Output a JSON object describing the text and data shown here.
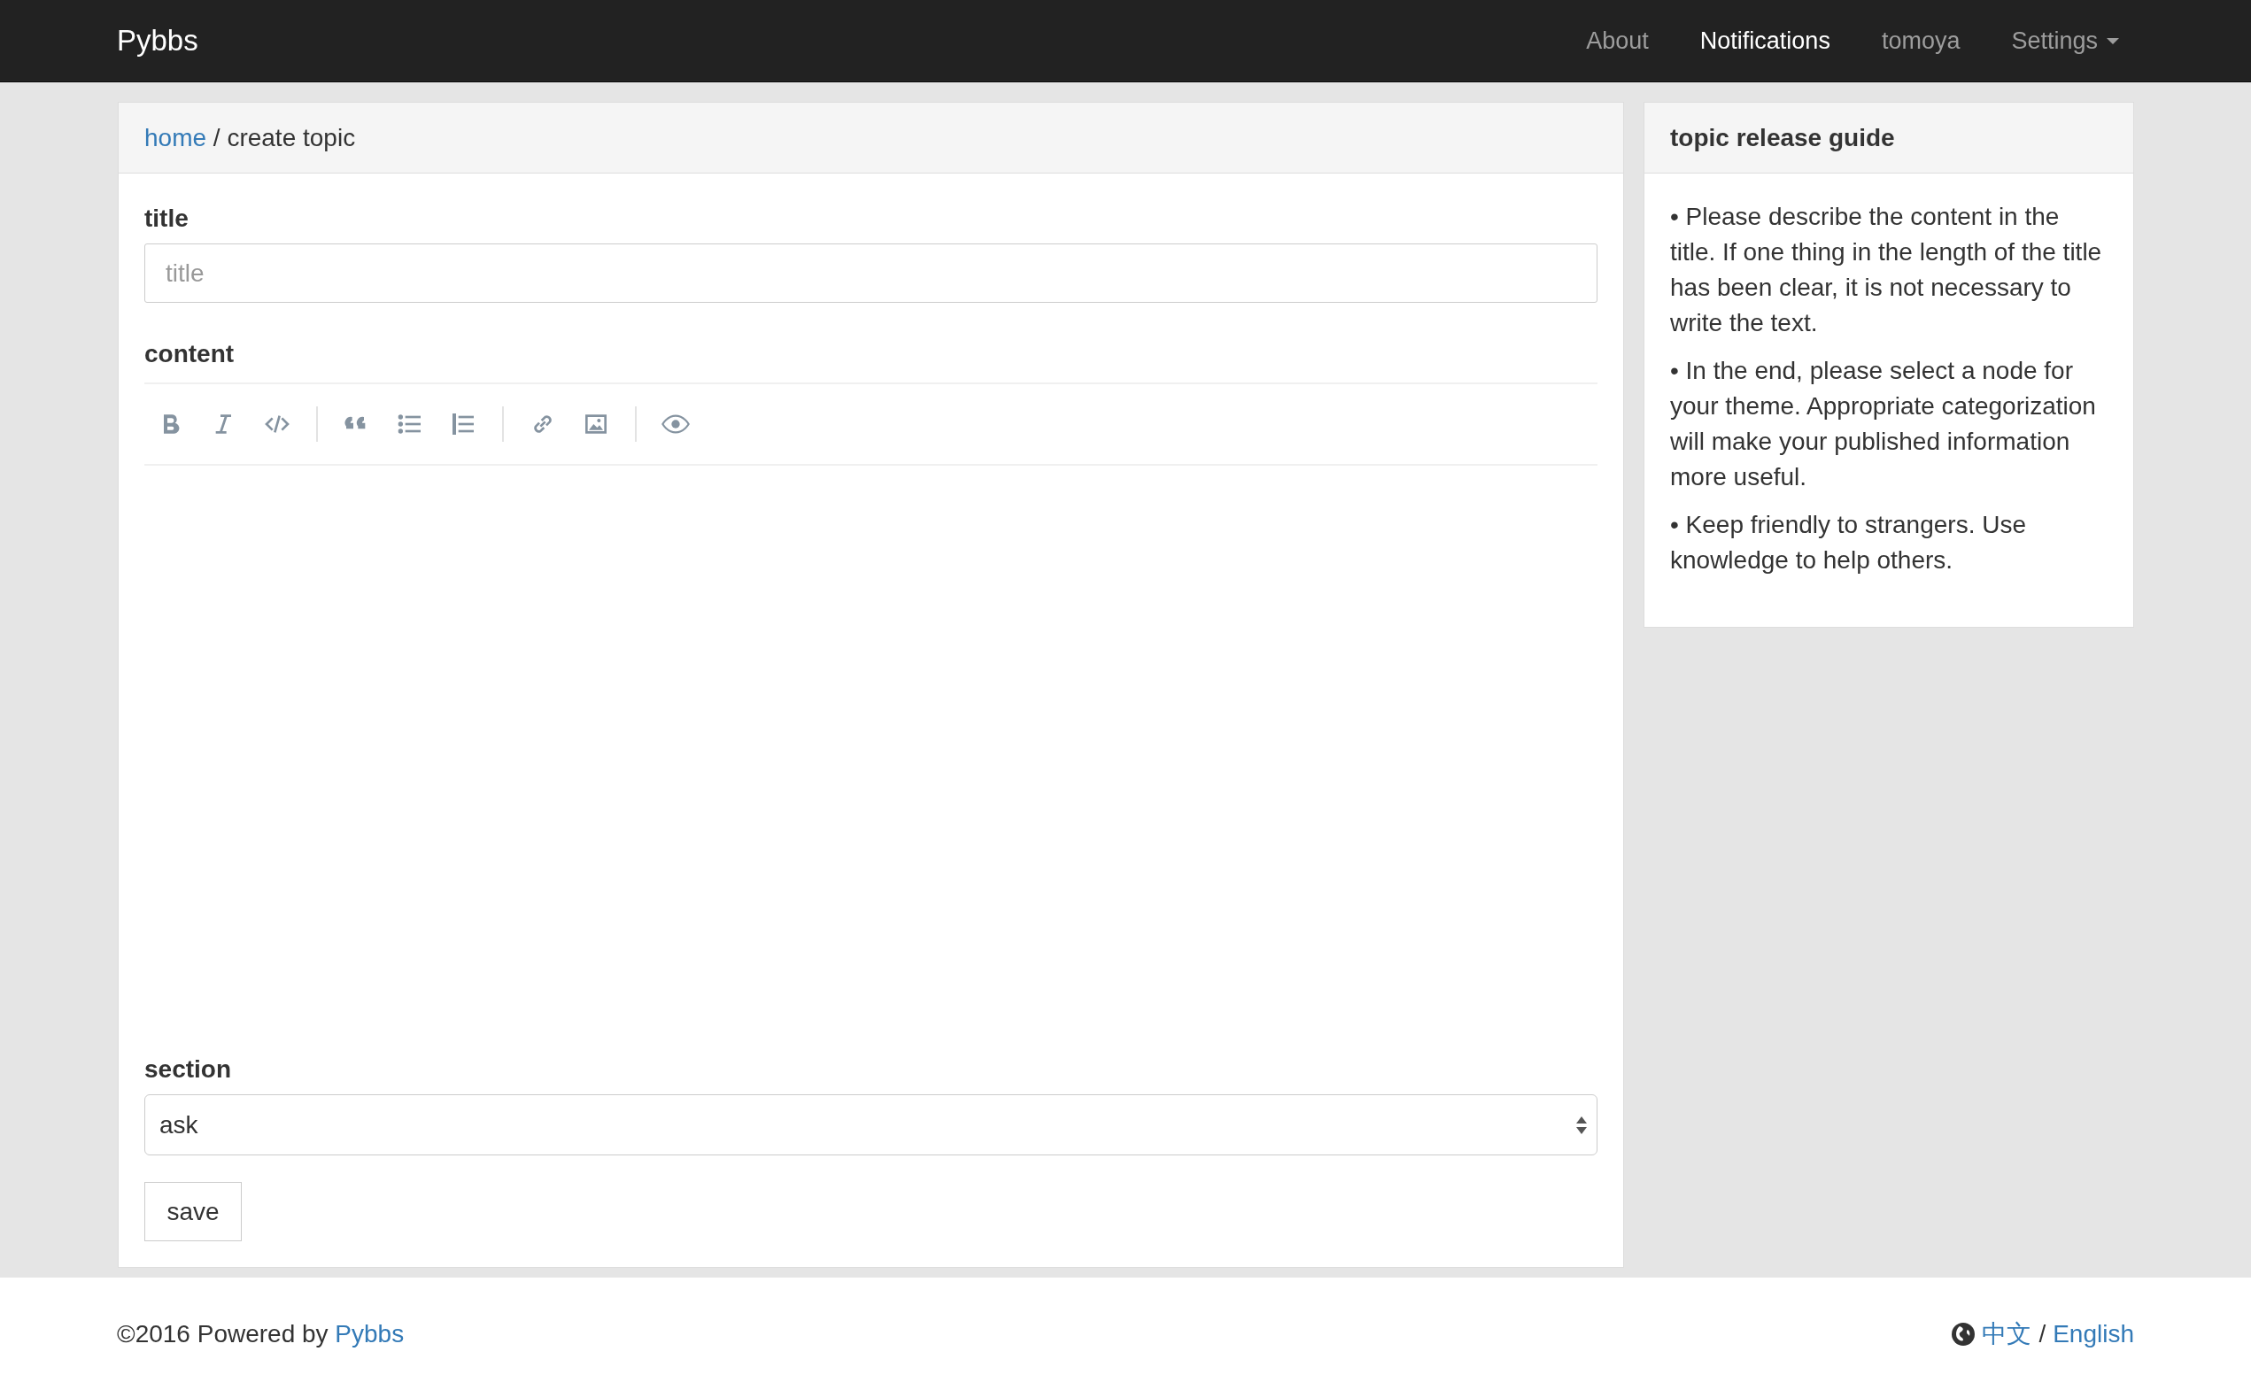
{
  "navbar": {
    "brand": "Pybbs",
    "items": [
      {
        "label": "About",
        "selected": false,
        "dropdown": false
      },
      {
        "label": "Notifications",
        "selected": true,
        "dropdown": false
      },
      {
        "label": "tomoya",
        "selected": false,
        "dropdown": false
      },
      {
        "label": "Settings",
        "selected": false,
        "dropdown": true
      }
    ]
  },
  "breadcrumb": {
    "link": "home",
    "separator": "/",
    "current": "create topic"
  },
  "form": {
    "title_label": "title",
    "title_placeholder": "title",
    "content_label": "content",
    "section_label": "section",
    "section_value": "ask",
    "save_button": "save"
  },
  "sidebar": {
    "title": "topic release guide",
    "paragraphs": [
      "• Please describe the content in the title. If one thing in the length of the title has been clear, it is not necessary to write the text.",
      "• In the end, please select a node for your theme. Appropriate categorization will make your published information more useful.",
      "• Keep friendly to strangers. Use knowledge to help others."
    ]
  },
  "footer": {
    "copyright": "©2016 Powered by ",
    "copyright_link": "Pybbs",
    "languages": [
      "中文",
      "English"
    ],
    "language_separator": "/"
  }
}
